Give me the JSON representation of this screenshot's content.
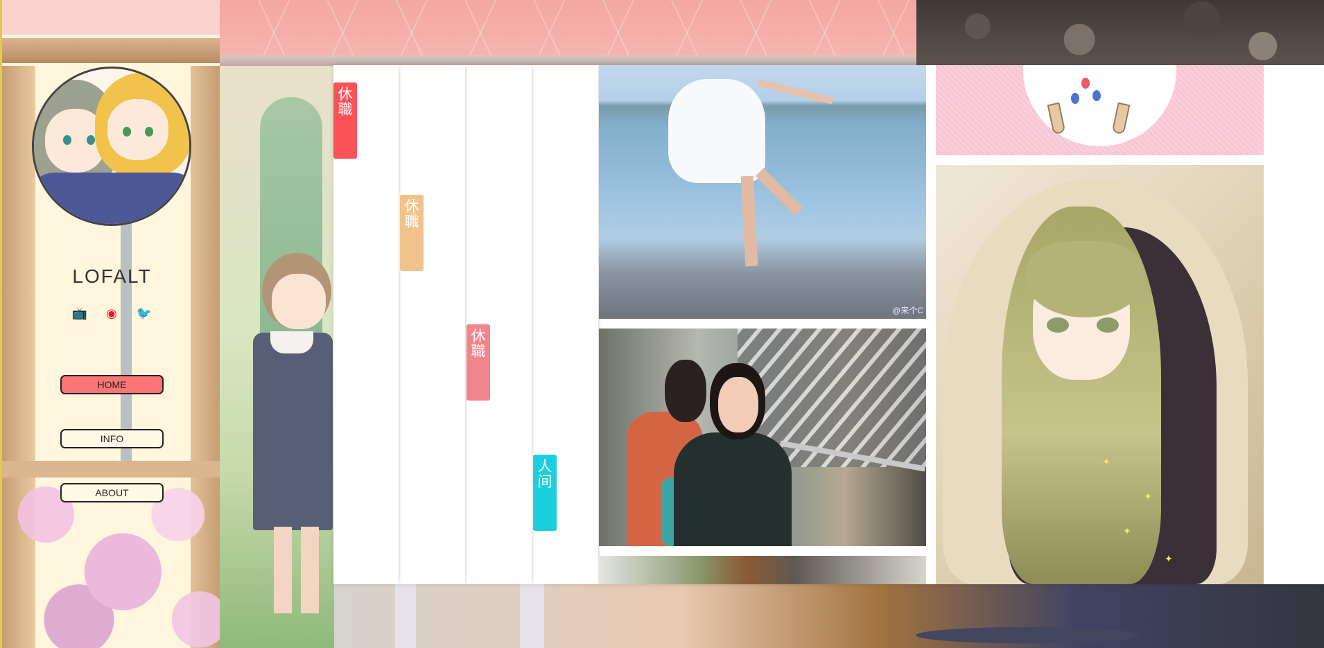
{
  "sidebar": {
    "site_title": "LOFALT",
    "social": [
      {
        "icon": "bilibili-icon",
        "glyph": "📺"
      },
      {
        "icon": "weibo-icon",
        "glyph": "◉"
      },
      {
        "icon": "twitter-icon",
        "glyph": "🐦"
      }
    ],
    "nav": [
      {
        "label": "HOME",
        "active": true
      },
      {
        "label": "INFO",
        "active": false
      },
      {
        "label": "ABOUT",
        "active": false
      }
    ]
  },
  "columns": [
    {
      "tag": "休職",
      "color": "#fb5258"
    },
    {
      "tag": "休職",
      "color": "#f1c38c"
    },
    {
      "tag": "休職",
      "color": "#f0868b"
    },
    {
      "tag": "人间",
      "color": "#1ccfdf"
    }
  ],
  "gallery": {
    "photo_watermark": "@来个C"
  },
  "colors": {
    "accent_nav": "#fb7575",
    "panel_bg": "#ffffff"
  }
}
